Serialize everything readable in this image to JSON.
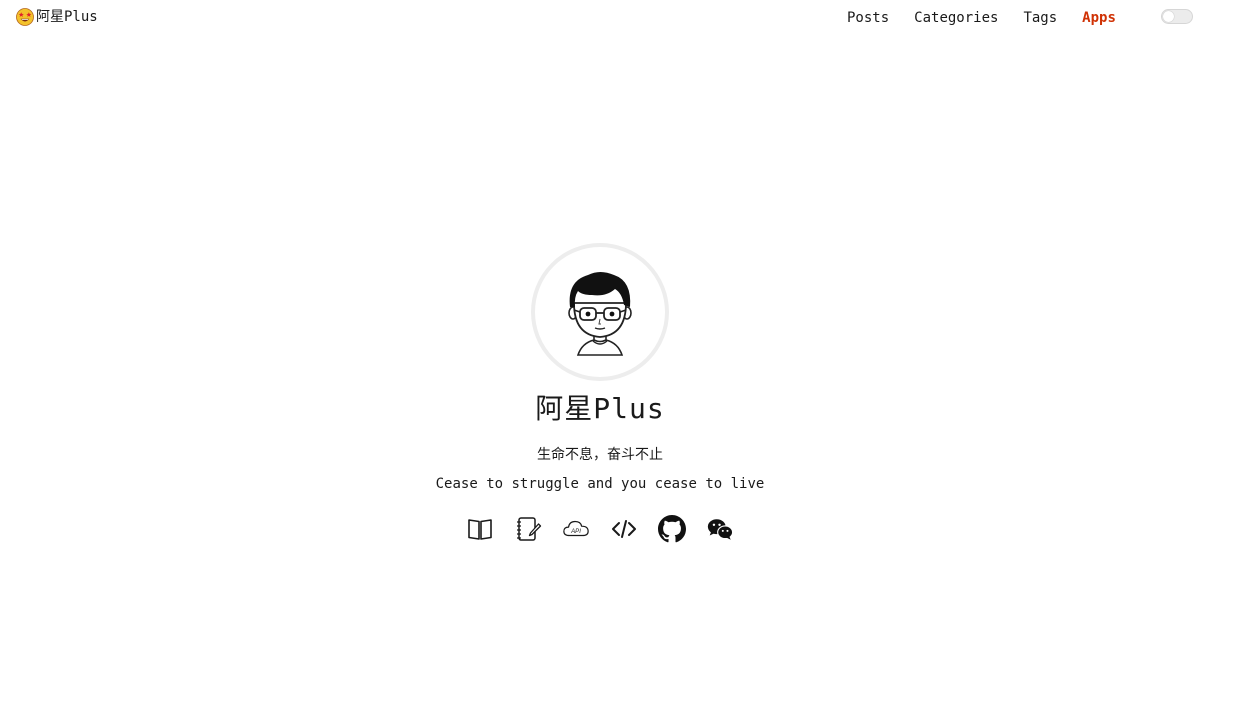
{
  "header": {
    "logo_text": "阿星Plus",
    "logo_icon": "star-struck-emoji-icon",
    "nav": [
      {
        "label": "Posts",
        "active": false
      },
      {
        "label": "Categories",
        "active": false
      },
      {
        "label": "Tags",
        "active": false
      },
      {
        "label": "Apps",
        "active": true
      }
    ],
    "theme_toggle": {
      "icon": "theme-toggle",
      "on": false
    }
  },
  "profile": {
    "avatar_icon": "avatar-cartoon-glasses",
    "title": "阿星Plus",
    "subtitle_cn": "生命不息，奋斗不止",
    "subtitle_en": "Cease to struggle and you cease to live",
    "social": [
      {
        "icon": "book-icon"
      },
      {
        "icon": "notebook-icon"
      },
      {
        "icon": "api-cloud-icon"
      },
      {
        "icon": "code-icon"
      },
      {
        "icon": "github-icon"
      },
      {
        "icon": "wechat-icon"
      }
    ]
  },
  "colors": {
    "accent": "#d03205",
    "text": "#1a1a1a",
    "avatar_ring": "#ededed",
    "background": "#ffffff"
  }
}
